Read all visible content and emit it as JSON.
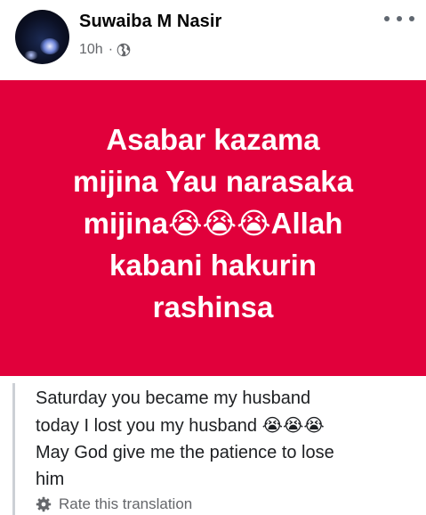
{
  "post": {
    "author": "Suwaiba M Nasir",
    "time": "10h",
    "separator": "·",
    "privacy_icon": "globe-icon",
    "more_icon": "more-options-icon"
  },
  "card": {
    "background": "#e1003b",
    "text_color": "#ffffff",
    "line1": "Asabar kazama",
    "line2": "mijina Yau narasaka",
    "line3_pre": "mijina",
    "emoji": "😭",
    "line3_post": "Allah",
    "line4": "kabani hakurin",
    "line5": "rashinsa"
  },
  "translation": {
    "line1": "Saturday you became my husband",
    "line2_pre": "today I lost you my husband ",
    "emoji": "😭",
    "line3": "May God give me the patience to lose",
    "line4": "him",
    "rate_label": "Rate this translation",
    "rate_icon": "gear-icon"
  }
}
